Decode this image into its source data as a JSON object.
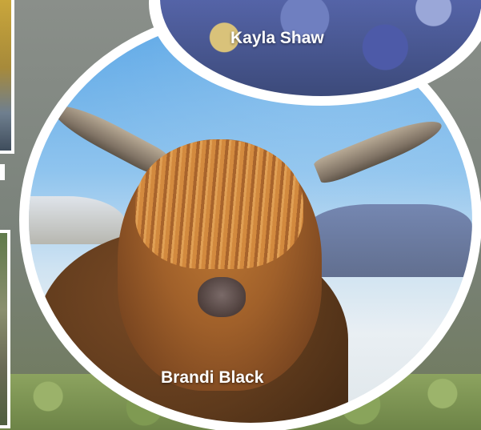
{
  "gallery": {
    "cards": [
      {
        "name": "Kayla Shaw"
      },
      {
        "name": "Brandi Black"
      }
    ]
  }
}
